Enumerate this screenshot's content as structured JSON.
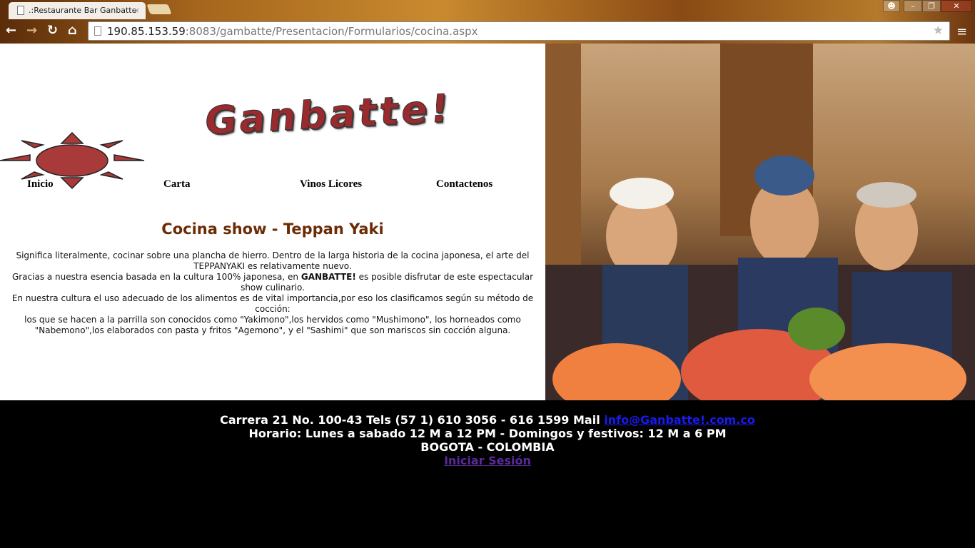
{
  "browser": {
    "tab_title": ".:Restaurante Bar Ganbatte",
    "url_host": "190.85.153.59",
    "url_rest": ":8083/gambatte/Presentacion/Formularios/cocina.aspx"
  },
  "logo": {
    "text": "Ganbatte!"
  },
  "menu": [
    "Inicio",
    "Carta",
    "Vinos Licores",
    "Contactenos"
  ],
  "content": {
    "title": "Cocina show - Teppan Yaki",
    "p1": "Significa literalmente, cocinar sobre una plancha de hierro. Dentro de la larga historia de la cocina japonesa, el arte del TEPPANYAKI es relativamente nuevo.",
    "p2a": "Gracias a nuestra esencia basada en la cultura 100% japonesa, en ",
    "p2b": "GANBATTE!",
    "p2c": " es posible disfrutar de este espectacular show culinario.",
    "p3": "En nuestra cultura el uso adecuado de los alimentos es de vital importancia,por eso los clasificamos según su método de cocción:",
    "p4": "los que se hacen a la parrilla son conocidos como \"Yakimono\",los hervidos como \"Mushimono\", los horneados como \"Nabemono\",los elaborados con pasta y fritos \"Agemono\", y el \"Sashimi\" que son mariscos sin cocción alguna."
  },
  "footer": {
    "address": "Carrera 21 No. 100-43 Tels (57 1) 610 3056 - 616 1599 Mail ",
    "email": "info@Ganbatte!.com.co",
    "hours": "Horario: Lunes a sabado 12 M a 12 PM - Domingos y festivos: 12 M a 6 PM",
    "city": "BOGOTA - COLOMBIA",
    "login": "Iniciar Sesión"
  }
}
